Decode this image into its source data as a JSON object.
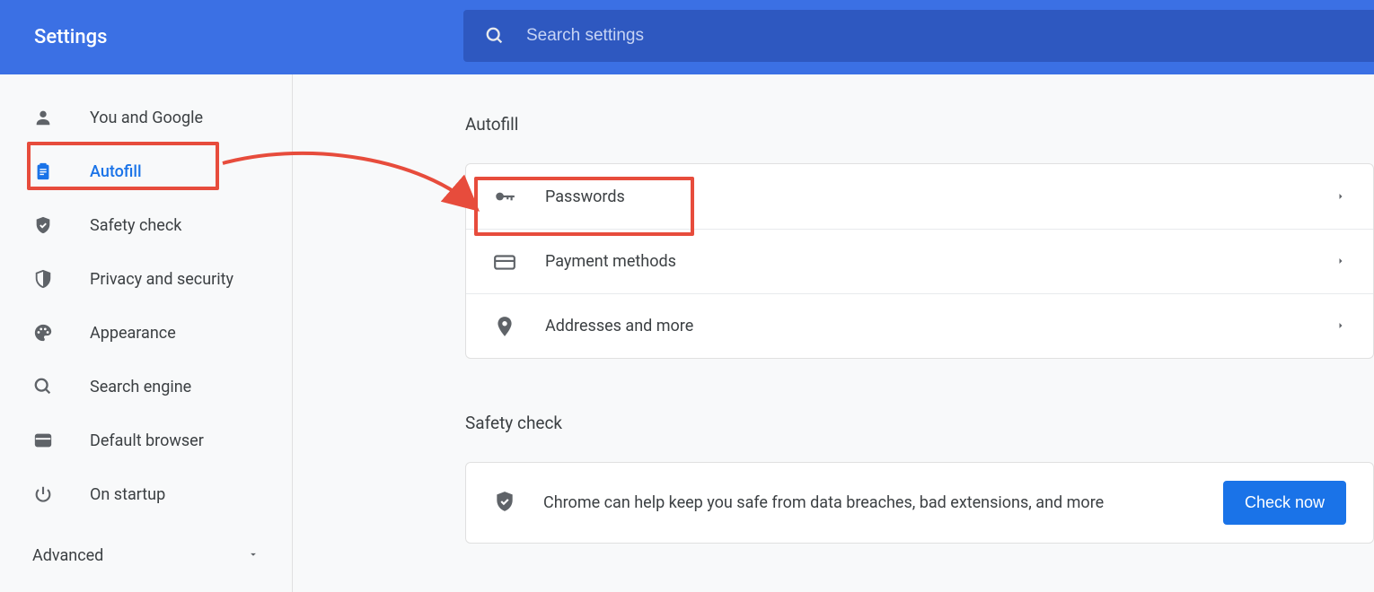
{
  "header": {
    "title": "Settings",
    "search_placeholder": "Search settings"
  },
  "sidebar": {
    "items": [
      {
        "id": "you-and-google",
        "label": "You and Google",
        "icon": "person"
      },
      {
        "id": "autofill",
        "label": "Autofill",
        "icon": "clipboard",
        "selected": true
      },
      {
        "id": "safety-check",
        "label": "Safety check",
        "icon": "shield-check"
      },
      {
        "id": "privacy-security",
        "label": "Privacy and security",
        "icon": "shield"
      },
      {
        "id": "appearance",
        "label": "Appearance",
        "icon": "palette"
      },
      {
        "id": "search-engine",
        "label": "Search engine",
        "icon": "search"
      },
      {
        "id": "default-browser",
        "label": "Default browser",
        "icon": "browser"
      },
      {
        "id": "on-startup",
        "label": "On startup",
        "icon": "power"
      }
    ],
    "advanced_label": "Advanced"
  },
  "main": {
    "autofill_section": {
      "title": "Autofill",
      "rows": [
        {
          "id": "passwords",
          "label": "Passwords",
          "icon": "key"
        },
        {
          "id": "payment-methods",
          "label": "Payment methods",
          "icon": "card"
        },
        {
          "id": "addresses",
          "label": "Addresses and more",
          "icon": "location"
        }
      ]
    },
    "safety_section": {
      "title": "Safety check",
      "text": "Chrome can help keep you safe from data breaches, bad extensions, and more",
      "button": "Check now"
    }
  },
  "annotations": {
    "highlight_color": "#e74c3c"
  }
}
